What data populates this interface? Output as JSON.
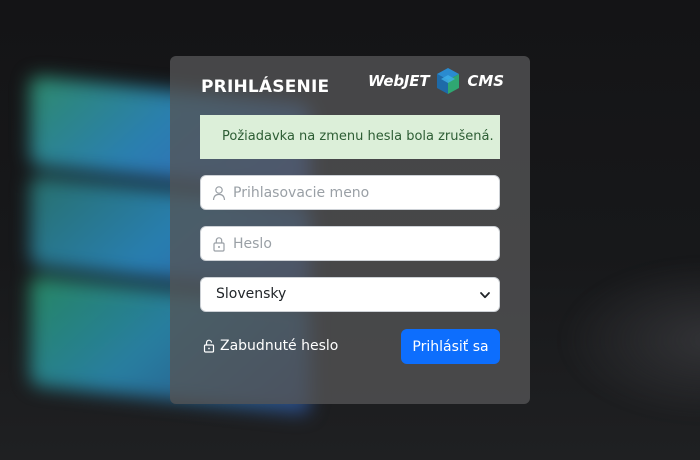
{
  "page": {
    "title": "PRIHLÁSENIE"
  },
  "logo": {
    "text_left": "WebJET",
    "text_right": "CMS",
    "icon": "webjet-cube-logo"
  },
  "alert": {
    "message": "Požiadavka na zmenu hesla bola zrušená.",
    "type": "success",
    "color": "#dcefd9"
  },
  "form": {
    "username": {
      "placeholder": "Prihlasovacie meno",
      "value": "",
      "icon": "user-icon"
    },
    "password": {
      "placeholder": "Heslo",
      "value": "",
      "icon": "lock-icon"
    },
    "language": {
      "selected": "Slovensky",
      "icon": "chevron-down-icon"
    },
    "forgot_password": {
      "label": "Zabudnuté heslo",
      "icon": "unlock-icon"
    },
    "submit": {
      "label": "Prihlásiť sa",
      "color": "#0d6efd"
    }
  }
}
